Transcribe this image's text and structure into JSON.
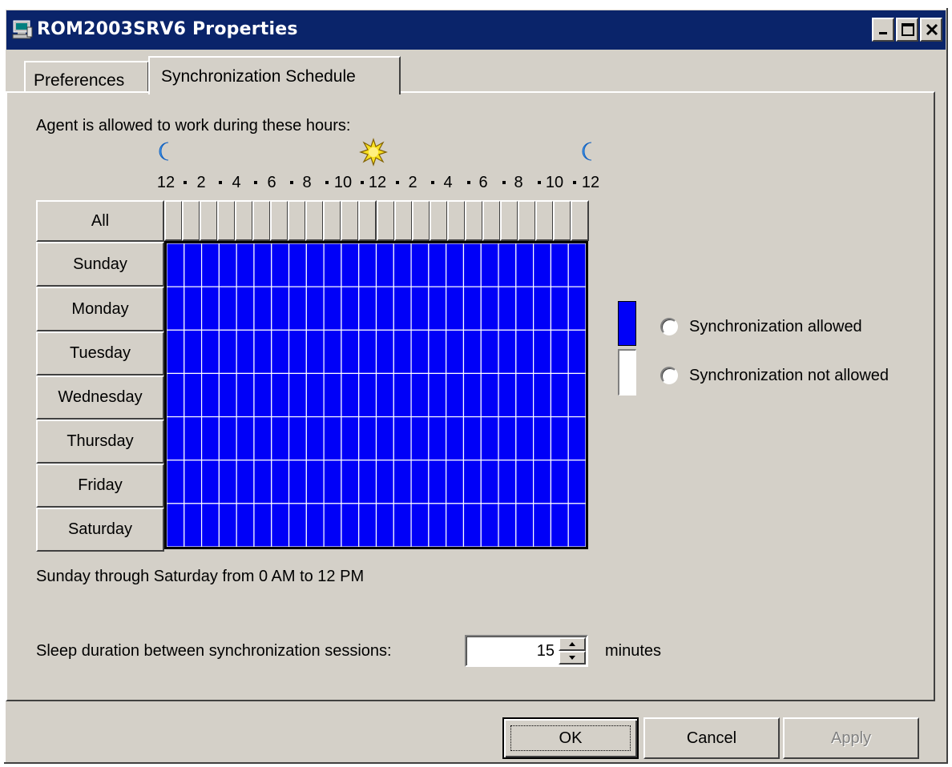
{
  "window": {
    "title": "ROM2003SRV6 Properties",
    "app_icon": "computer-network-icon",
    "controls": [
      "minimize-icon",
      "maximize-icon",
      "close-icon"
    ]
  },
  "tabs": [
    {
      "label": "Preferences",
      "active": false
    },
    {
      "label": "Synchronization Schedule",
      "active": true
    }
  ],
  "schedule": {
    "caption": "Agent is allowed to work during these hours:",
    "hour_labels": [
      "12",
      "2",
      "4",
      "6",
      "8",
      "10",
      "12",
      "2",
      "4",
      "6",
      "8",
      "10",
      "12"
    ],
    "hour_icons": [
      "moon-icon",
      "sun-icon",
      "moon-icon"
    ],
    "all_label": "All",
    "days": [
      "Sunday",
      "Monday",
      "Tuesday",
      "Wednesday",
      "Thursday",
      "Friday",
      "Saturday"
    ],
    "hours_per_day": 24,
    "allowed_color": "#0000f8",
    "not_allowed_color": "#ffffff",
    "summary": "Sunday through Saturday from 0 AM to 12 PM"
  },
  "legend": {
    "allowed_label": "Synchronization allowed",
    "not_allowed_label": "Synchronization not allowed"
  },
  "sleep": {
    "label": "Sleep duration between synchronization sessions:",
    "value": "15",
    "unit": "minutes"
  },
  "buttons": {
    "ok": "OK",
    "cancel": "Cancel",
    "apply": "Apply"
  }
}
